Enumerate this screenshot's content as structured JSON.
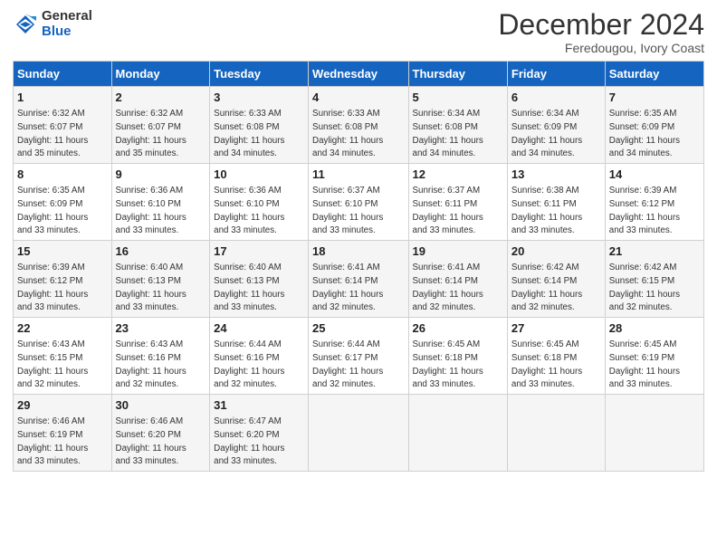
{
  "logo": {
    "general": "General",
    "blue": "Blue"
  },
  "title": "December 2024",
  "location": "Feredougou, Ivory Coast",
  "days_of_week": [
    "Sunday",
    "Monday",
    "Tuesday",
    "Wednesday",
    "Thursday",
    "Friday",
    "Saturday"
  ],
  "weeks": [
    [
      {
        "day": 1,
        "sunrise": "6:32 AM",
        "sunset": "6:07 PM",
        "daylight": "11 hours and 35 minutes."
      },
      {
        "day": 2,
        "sunrise": "6:32 AM",
        "sunset": "6:07 PM",
        "daylight": "11 hours and 35 minutes."
      },
      {
        "day": 3,
        "sunrise": "6:33 AM",
        "sunset": "6:08 PM",
        "daylight": "11 hours and 34 minutes."
      },
      {
        "day": 4,
        "sunrise": "6:33 AM",
        "sunset": "6:08 PM",
        "daylight": "11 hours and 34 minutes."
      },
      {
        "day": 5,
        "sunrise": "6:34 AM",
        "sunset": "6:08 PM",
        "daylight": "11 hours and 34 minutes."
      },
      {
        "day": 6,
        "sunrise": "6:34 AM",
        "sunset": "6:09 PM",
        "daylight": "11 hours and 34 minutes."
      },
      {
        "day": 7,
        "sunrise": "6:35 AM",
        "sunset": "6:09 PM",
        "daylight": "11 hours and 34 minutes."
      }
    ],
    [
      {
        "day": 8,
        "sunrise": "6:35 AM",
        "sunset": "6:09 PM",
        "daylight": "11 hours and 33 minutes."
      },
      {
        "day": 9,
        "sunrise": "6:36 AM",
        "sunset": "6:10 PM",
        "daylight": "11 hours and 33 minutes."
      },
      {
        "day": 10,
        "sunrise": "6:36 AM",
        "sunset": "6:10 PM",
        "daylight": "11 hours and 33 minutes."
      },
      {
        "day": 11,
        "sunrise": "6:37 AM",
        "sunset": "6:10 PM",
        "daylight": "11 hours and 33 minutes."
      },
      {
        "day": 12,
        "sunrise": "6:37 AM",
        "sunset": "6:11 PM",
        "daylight": "11 hours and 33 minutes."
      },
      {
        "day": 13,
        "sunrise": "6:38 AM",
        "sunset": "6:11 PM",
        "daylight": "11 hours and 33 minutes."
      },
      {
        "day": 14,
        "sunrise": "6:39 AM",
        "sunset": "6:12 PM",
        "daylight": "11 hours and 33 minutes."
      }
    ],
    [
      {
        "day": 15,
        "sunrise": "6:39 AM",
        "sunset": "6:12 PM",
        "daylight": "11 hours and 33 minutes."
      },
      {
        "day": 16,
        "sunrise": "6:40 AM",
        "sunset": "6:13 PM",
        "daylight": "11 hours and 33 minutes."
      },
      {
        "day": 17,
        "sunrise": "6:40 AM",
        "sunset": "6:13 PM",
        "daylight": "11 hours and 33 minutes."
      },
      {
        "day": 18,
        "sunrise": "6:41 AM",
        "sunset": "6:14 PM",
        "daylight": "11 hours and 32 minutes."
      },
      {
        "day": 19,
        "sunrise": "6:41 AM",
        "sunset": "6:14 PM",
        "daylight": "11 hours and 32 minutes."
      },
      {
        "day": 20,
        "sunrise": "6:42 AM",
        "sunset": "6:14 PM",
        "daylight": "11 hours and 32 minutes."
      },
      {
        "day": 21,
        "sunrise": "6:42 AM",
        "sunset": "6:15 PM",
        "daylight": "11 hours and 32 minutes."
      }
    ],
    [
      {
        "day": 22,
        "sunrise": "6:43 AM",
        "sunset": "6:15 PM",
        "daylight": "11 hours and 32 minutes."
      },
      {
        "day": 23,
        "sunrise": "6:43 AM",
        "sunset": "6:16 PM",
        "daylight": "11 hours and 32 minutes."
      },
      {
        "day": 24,
        "sunrise": "6:44 AM",
        "sunset": "6:16 PM",
        "daylight": "11 hours and 32 minutes."
      },
      {
        "day": 25,
        "sunrise": "6:44 AM",
        "sunset": "6:17 PM",
        "daylight": "11 hours and 32 minutes."
      },
      {
        "day": 26,
        "sunrise": "6:45 AM",
        "sunset": "6:18 PM",
        "daylight": "11 hours and 33 minutes."
      },
      {
        "day": 27,
        "sunrise": "6:45 AM",
        "sunset": "6:18 PM",
        "daylight": "11 hours and 33 minutes."
      },
      {
        "day": 28,
        "sunrise": "6:45 AM",
        "sunset": "6:19 PM",
        "daylight": "11 hours and 33 minutes."
      }
    ],
    [
      {
        "day": 29,
        "sunrise": "6:46 AM",
        "sunset": "6:19 PM",
        "daylight": "11 hours and 33 minutes."
      },
      {
        "day": 30,
        "sunrise": "6:46 AM",
        "sunset": "6:20 PM",
        "daylight": "11 hours and 33 minutes."
      },
      {
        "day": 31,
        "sunrise": "6:47 AM",
        "sunset": "6:20 PM",
        "daylight": "11 hours and 33 minutes."
      },
      null,
      null,
      null,
      null
    ]
  ]
}
